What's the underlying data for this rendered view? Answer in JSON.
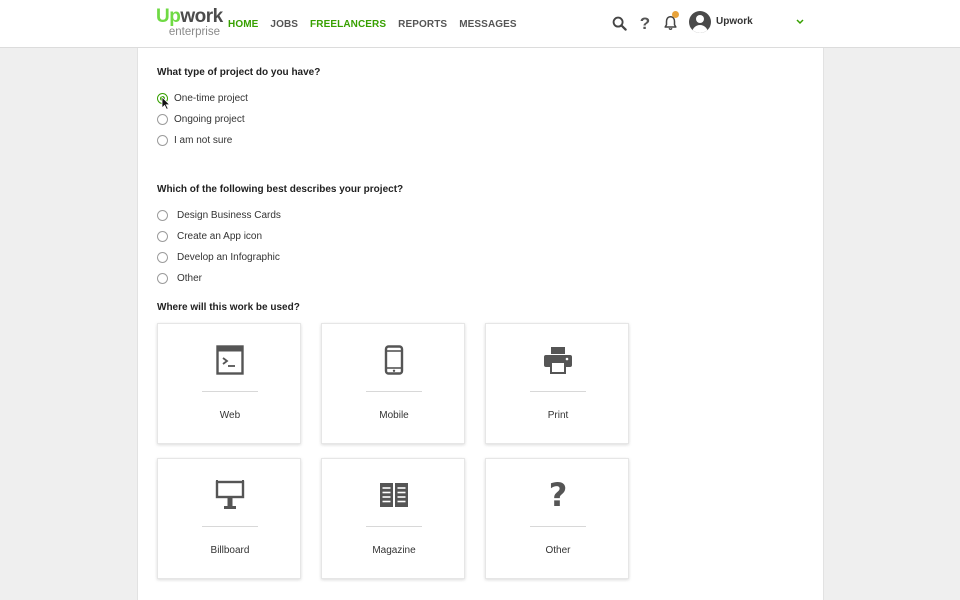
{
  "header": {
    "logo": {
      "brand_up": "Up",
      "brand_rest": "work",
      "sub": "enterprise"
    },
    "nav": [
      {
        "label": "HOME",
        "active": true
      },
      {
        "label": "JOBS",
        "active": false
      },
      {
        "label": "FREELANCERS",
        "active": true
      },
      {
        "label": "REPORTS",
        "active": false
      },
      {
        "label": "MESSAGES",
        "active": false
      }
    ],
    "icons": [
      "search-icon",
      "help-icon",
      "bell-icon",
      "user-avatar",
      "chevron-down-icon"
    ],
    "help_glyph": "?",
    "user_name": "Upwork",
    "notification_dot_color": "#e8a33b"
  },
  "colors": {
    "brand_green": "#37a000",
    "logo_green": "#6fda44",
    "background": "#efefef"
  },
  "form": {
    "project_type": {
      "question": "What type of project do you have?",
      "options": [
        {
          "label": "One-time project",
          "selected": true
        },
        {
          "label": "Ongoing project",
          "selected": false
        },
        {
          "label": "I am not sure",
          "selected": false
        }
      ]
    },
    "project_description": {
      "question": "Which of the following best describes your project?",
      "options": [
        {
          "label": "Design Business Cards",
          "selected": false
        },
        {
          "label": "Create an App icon",
          "selected": false
        },
        {
          "label": "Develop an Infographic",
          "selected": false
        },
        {
          "label": "Other",
          "selected": false
        }
      ]
    },
    "usage": {
      "question": "Where will this work be used?",
      "cards": [
        {
          "label": "Web",
          "icon": "browser-window-icon"
        },
        {
          "label": "Mobile",
          "icon": "mobile-phone-icon"
        },
        {
          "label": "Print",
          "icon": "printer-icon"
        },
        {
          "label": "Billboard",
          "icon": "billboard-icon"
        },
        {
          "label": "Magazine",
          "icon": "magazine-icon"
        },
        {
          "label": "Other",
          "icon": "question-mark-icon",
          "glyph": "?"
        }
      ]
    }
  }
}
